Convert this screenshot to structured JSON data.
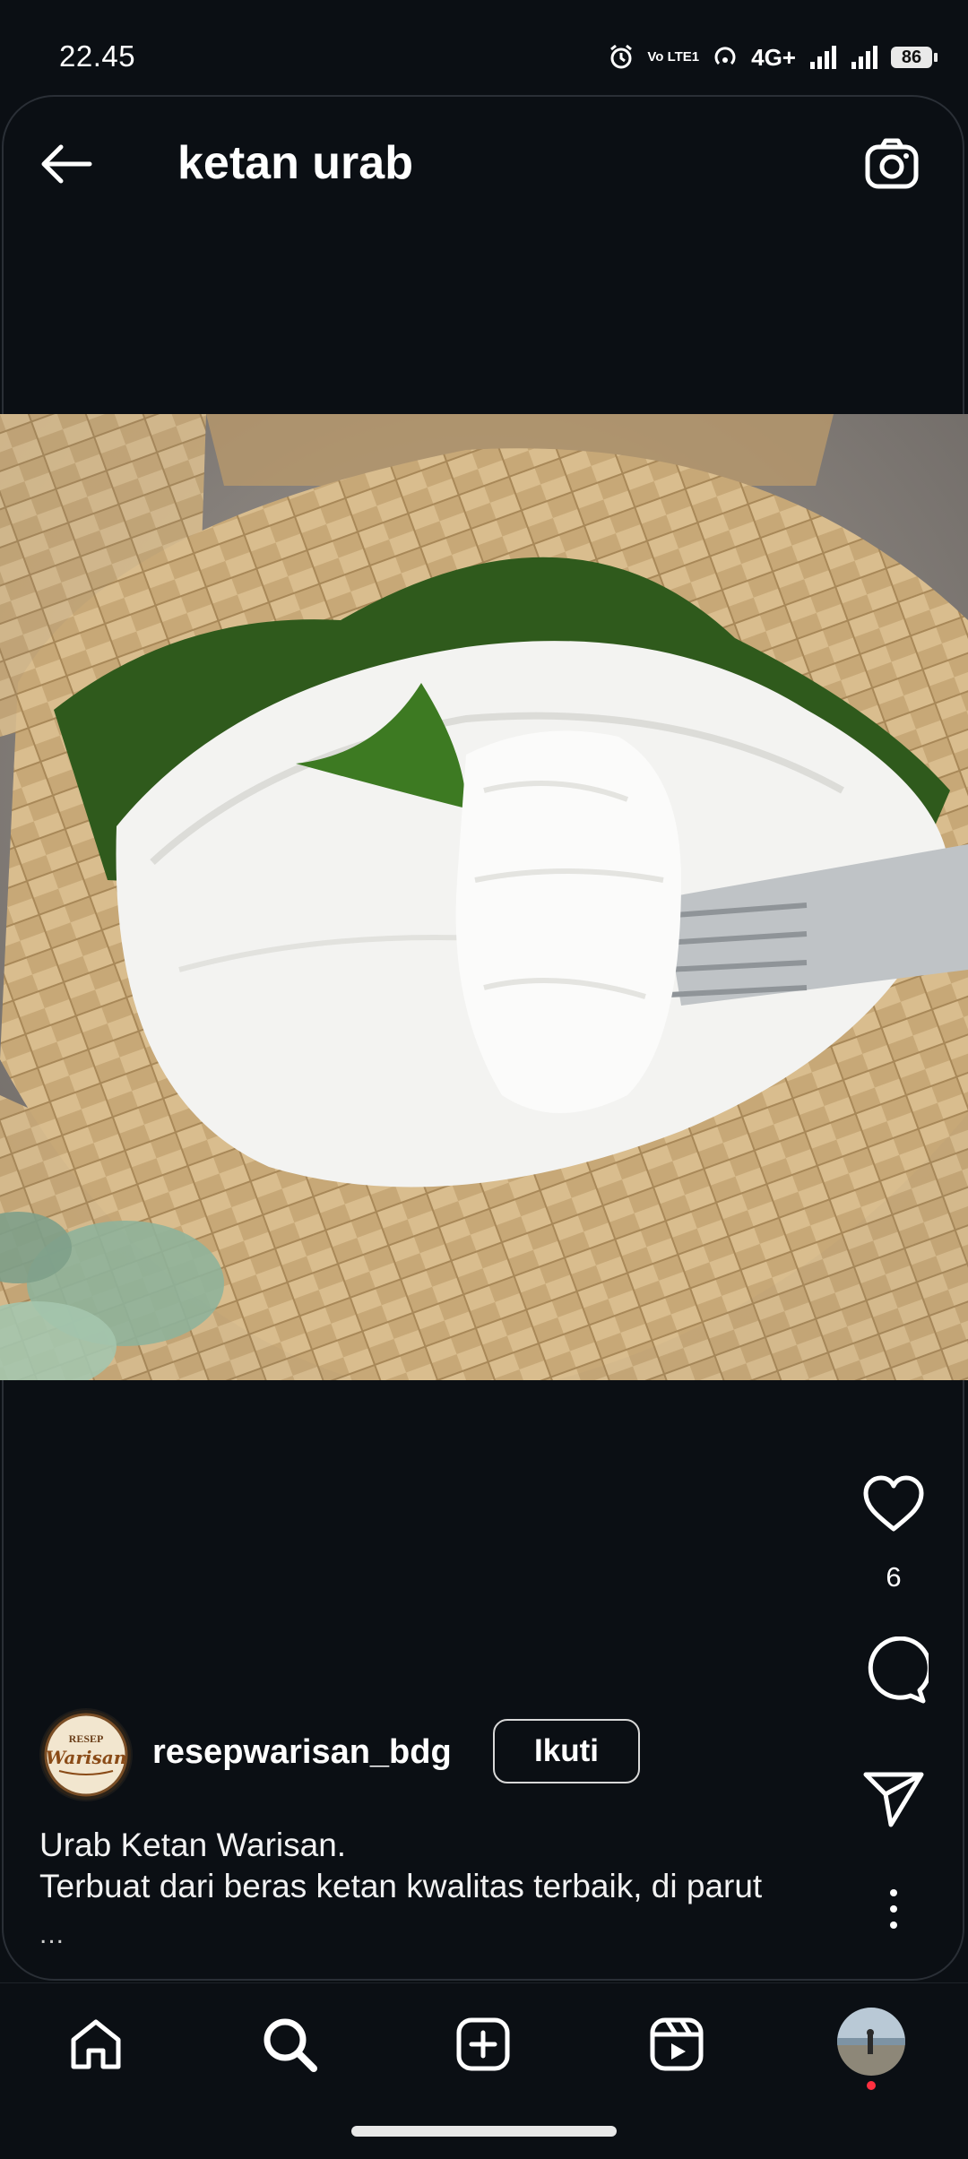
{
  "status_bar": {
    "time": "22.45",
    "network": "4G+",
    "volte": "Vo LTE1",
    "battery": "86"
  },
  "header": {
    "title": "ketan urab",
    "back_icon": "arrow-left-icon",
    "camera_icon": "camera-icon"
  },
  "post": {
    "photo_subject": "urab ketan in a woven bamboo basket with fork",
    "likes": "6",
    "author": {
      "username": "resepwarisan_bdg",
      "follow_label": "Ikuti",
      "avatar_logo_top": "RESEP",
      "avatar_logo_script": "Warisan"
    },
    "caption_lines": [
      "Urab Ketan Warisan.",
      "Terbuat dari beras ketan kwalitas terbaik, di parut"
    ],
    "caption_more": "..."
  },
  "actions": {
    "like_icon": "heart-icon",
    "comment_icon": "comment-icon",
    "share_icon": "send-icon",
    "more_icon": "more-vertical-icon"
  },
  "bottom_nav": {
    "items": [
      "home-icon",
      "search-icon",
      "create-icon",
      "reels-icon",
      "profile-avatar"
    ]
  }
}
